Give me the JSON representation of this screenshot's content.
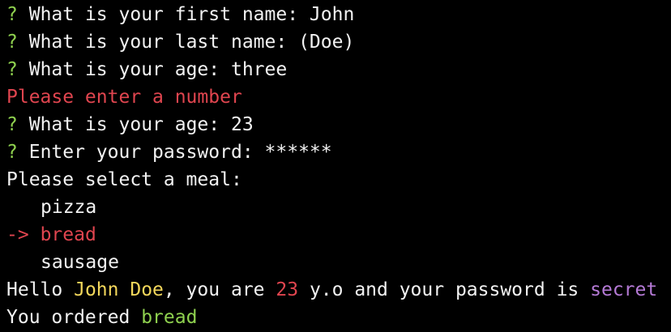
{
  "colors": {
    "background": "#000000",
    "foreground": "#f2f2f2",
    "prompt_mark": "#8fd14f",
    "error": "#e0454f",
    "highlight_name": "#f3d75b",
    "highlight_number": "#e0454f",
    "highlight_secret": "#b57ad6",
    "highlight_meal": "#8fd14f"
  },
  "prompt_mark": "?",
  "questions": {
    "first_name": {
      "label": "What is your first name:",
      "answer": "John"
    },
    "last_name": {
      "label": "What is your last name:",
      "answer": "(Doe)"
    },
    "age_first": {
      "label": "What is your age:",
      "answer": "three"
    },
    "age_error": "Please enter a number",
    "age_second": {
      "label": "What is your age:",
      "answer": "23"
    },
    "password": {
      "label": "Enter your password:",
      "answer": "******"
    }
  },
  "meal_menu": {
    "heading": "Please select a meal:",
    "pointer": "->",
    "options": [
      "pizza",
      "bread",
      "sausage"
    ],
    "selected": "bread"
  },
  "summary": {
    "prefix": "Hello",
    "full_name": "John Doe",
    "middle": ", you are",
    "age": "23",
    "suffix": "y.o and your password is",
    "secret": "secret"
  },
  "order": {
    "prefix": "You ordered",
    "item": "bread"
  }
}
